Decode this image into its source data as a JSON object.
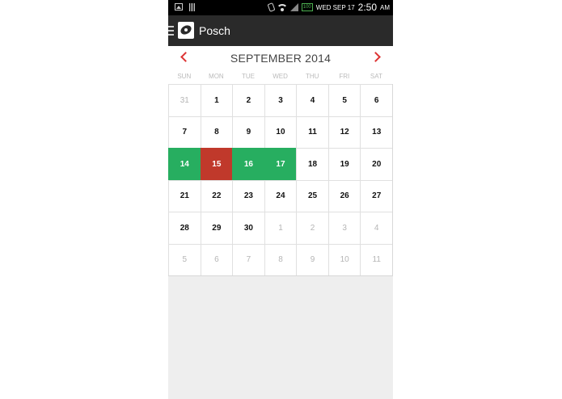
{
  "status_bar": {
    "battery": "100",
    "date": "WED SEP 17",
    "time": "2:50",
    "ampm": "AM"
  },
  "app": {
    "title": "Posch"
  },
  "calendar": {
    "month_title": "SEPTEMBER 2014",
    "weekdays": [
      "SUN",
      "MON",
      "TUE",
      "WED",
      "THU",
      "FRI",
      "SAT"
    ],
    "days": [
      {
        "n": "31",
        "state": "other"
      },
      {
        "n": "1",
        "state": "normal"
      },
      {
        "n": "2",
        "state": "normal"
      },
      {
        "n": "3",
        "state": "normal"
      },
      {
        "n": "4",
        "state": "normal"
      },
      {
        "n": "5",
        "state": "normal"
      },
      {
        "n": "6",
        "state": "normal"
      },
      {
        "n": "7",
        "state": "normal"
      },
      {
        "n": "8",
        "state": "normal"
      },
      {
        "n": "9",
        "state": "normal"
      },
      {
        "n": "10",
        "state": "normal"
      },
      {
        "n": "11",
        "state": "normal"
      },
      {
        "n": "12",
        "state": "normal"
      },
      {
        "n": "13",
        "state": "normal"
      },
      {
        "n": "14",
        "state": "green"
      },
      {
        "n": "15",
        "state": "red"
      },
      {
        "n": "16",
        "state": "green"
      },
      {
        "n": "17",
        "state": "green"
      },
      {
        "n": "18",
        "state": "normal"
      },
      {
        "n": "19",
        "state": "normal"
      },
      {
        "n": "20",
        "state": "normal"
      },
      {
        "n": "21",
        "state": "normal"
      },
      {
        "n": "22",
        "state": "normal"
      },
      {
        "n": "23",
        "state": "normal"
      },
      {
        "n": "24",
        "state": "normal"
      },
      {
        "n": "25",
        "state": "normal"
      },
      {
        "n": "26",
        "state": "normal"
      },
      {
        "n": "27",
        "state": "normal"
      },
      {
        "n": "28",
        "state": "normal"
      },
      {
        "n": "29",
        "state": "normal"
      },
      {
        "n": "30",
        "state": "normal"
      },
      {
        "n": "1",
        "state": "other"
      },
      {
        "n": "2",
        "state": "other"
      },
      {
        "n": "3",
        "state": "other"
      },
      {
        "n": "4",
        "state": "other"
      },
      {
        "n": "5",
        "state": "other"
      },
      {
        "n": "6",
        "state": "other"
      },
      {
        "n": "7",
        "state": "other"
      },
      {
        "n": "8",
        "state": "other"
      },
      {
        "n": "9",
        "state": "other"
      },
      {
        "n": "10",
        "state": "other"
      },
      {
        "n": "11",
        "state": "other"
      }
    ]
  },
  "colors": {
    "green": "#27ae60",
    "red": "#c0392b",
    "accent": "#dd3333"
  }
}
